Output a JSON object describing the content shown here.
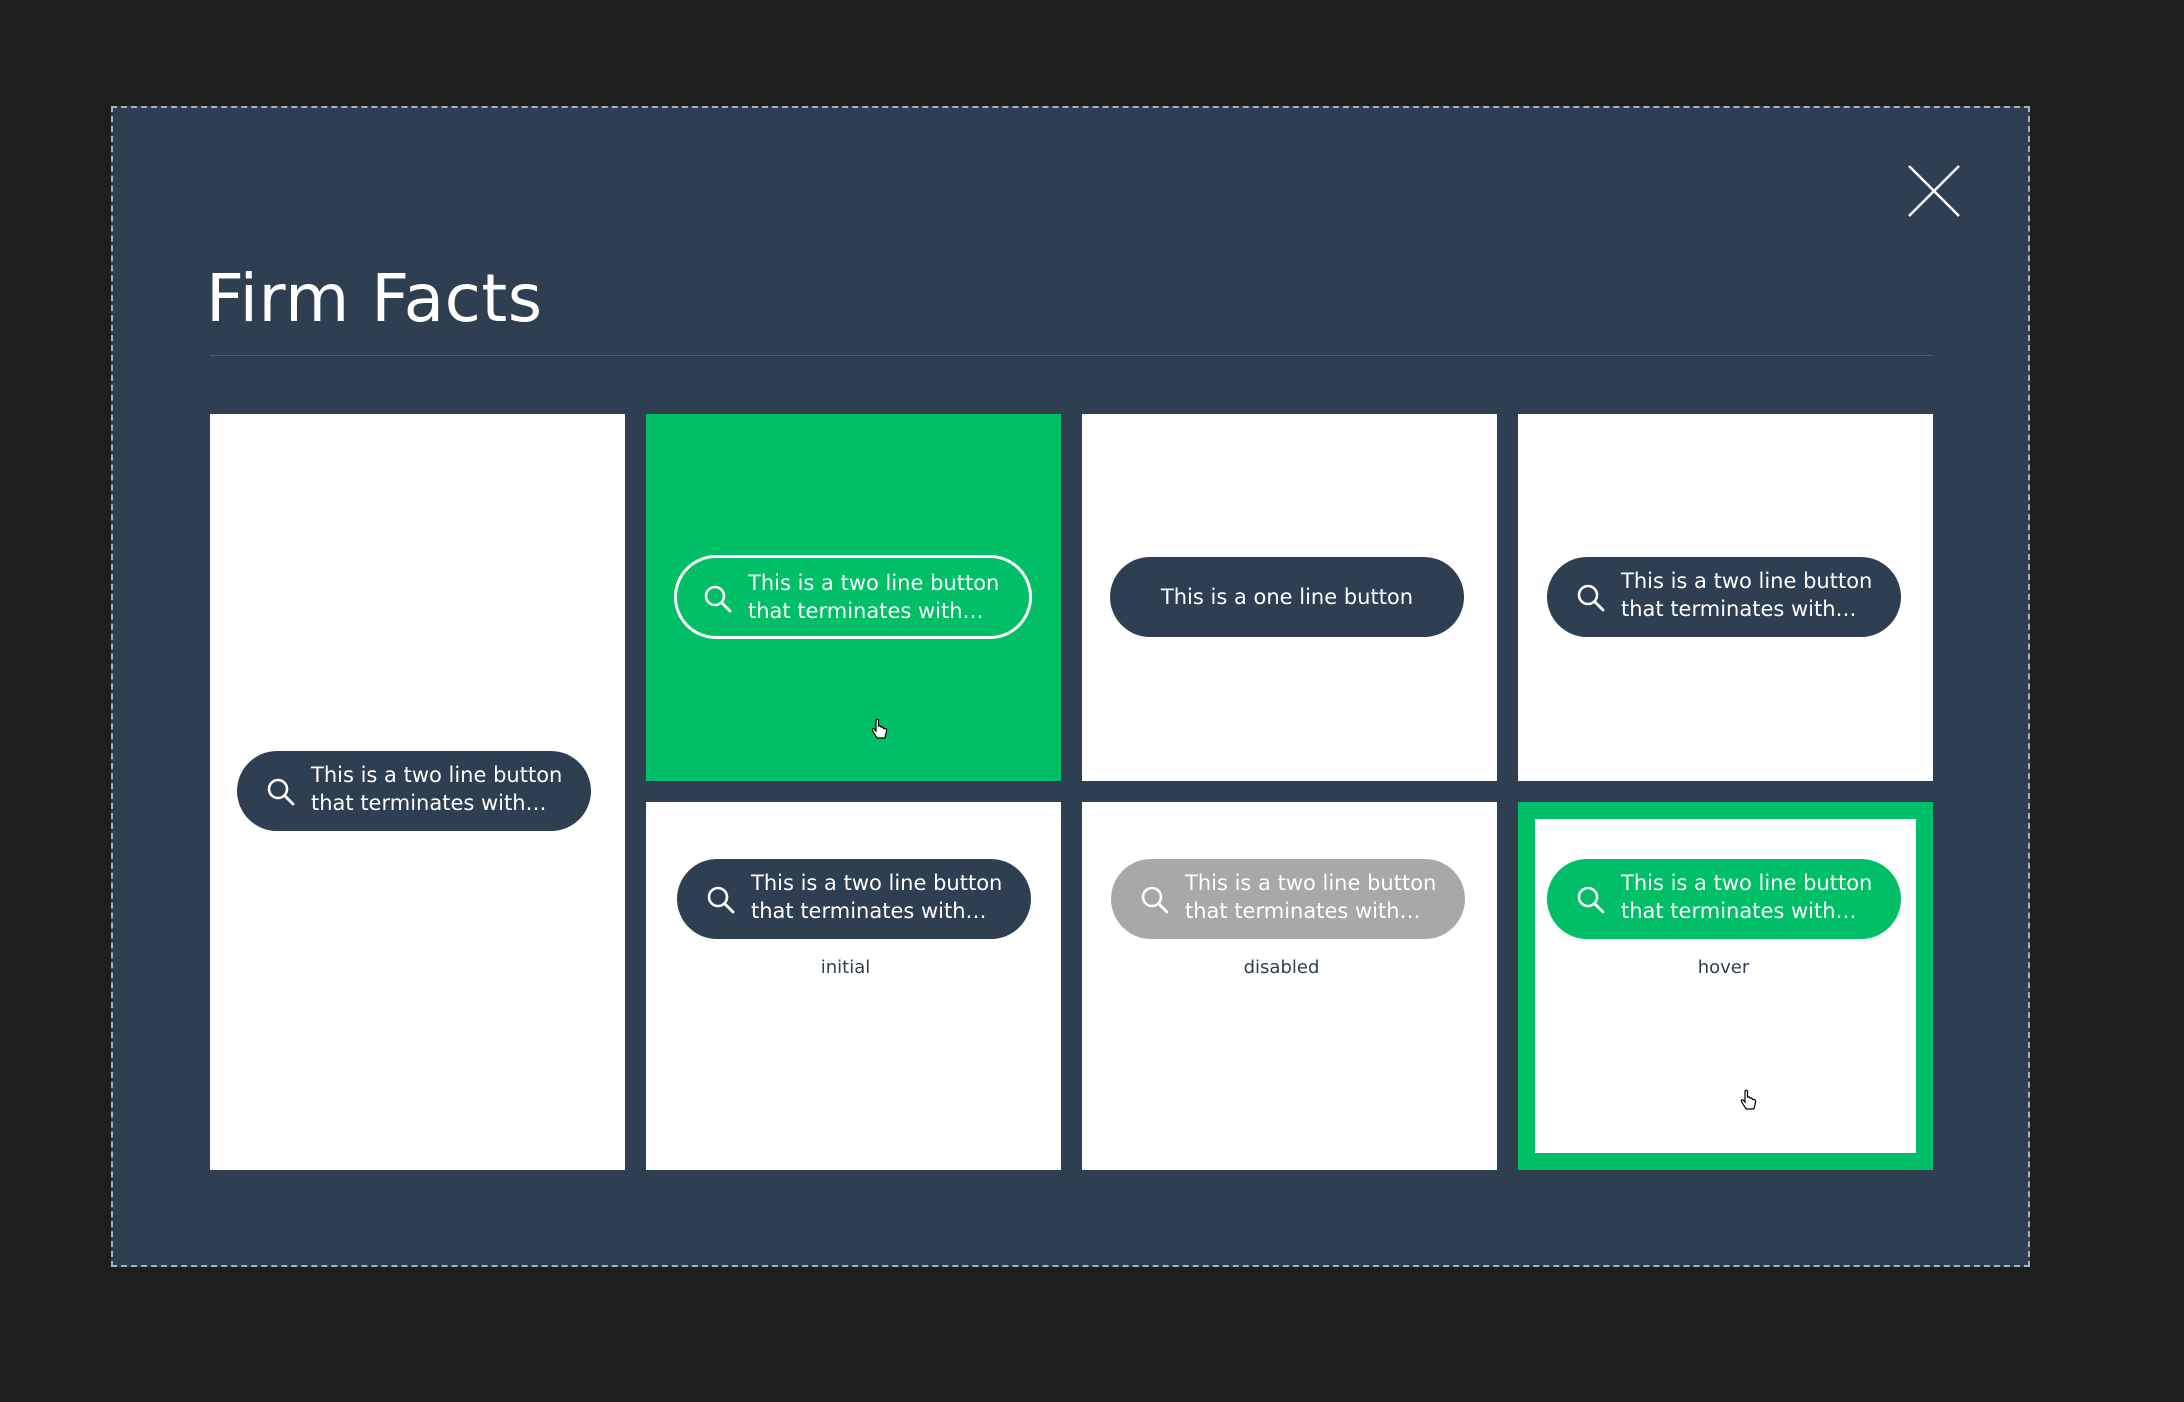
{
  "modal": {
    "title": "Firm Facts",
    "close_icon": "close-icon"
  },
  "tiles": {
    "tall": {
      "button_label": "This is a two line button\nthat terminates with…",
      "icon": "search-icon"
    },
    "green_tile": {
      "button_label": "This is a two line button\nthat terminates with…",
      "icon": "search-icon"
    },
    "one_line": {
      "button_label": "This is a one line button"
    },
    "top_right": {
      "button_label": "This is a two line button\nthat terminates with…",
      "icon": "search-icon"
    },
    "initial": {
      "button_label": "This is a two line button\nthat terminates with…",
      "caption": "initial",
      "icon": "search-icon"
    },
    "disabled": {
      "button_label": "This is a two line button\nthat terminates with…",
      "caption": "disabled",
      "icon": "search-icon"
    },
    "hover": {
      "button_label": "This is a two line button\nthat terminates with…",
      "caption": "hover",
      "icon": "search-icon"
    }
  },
  "colors": {
    "backdrop": "#1e1e1e",
    "modal_bg": "#2e3f51",
    "accent_green": "#00bf66",
    "button_dark": "#2e3f51",
    "button_disabled": "#a8a8a8",
    "tile_bg": "#ffffff"
  }
}
